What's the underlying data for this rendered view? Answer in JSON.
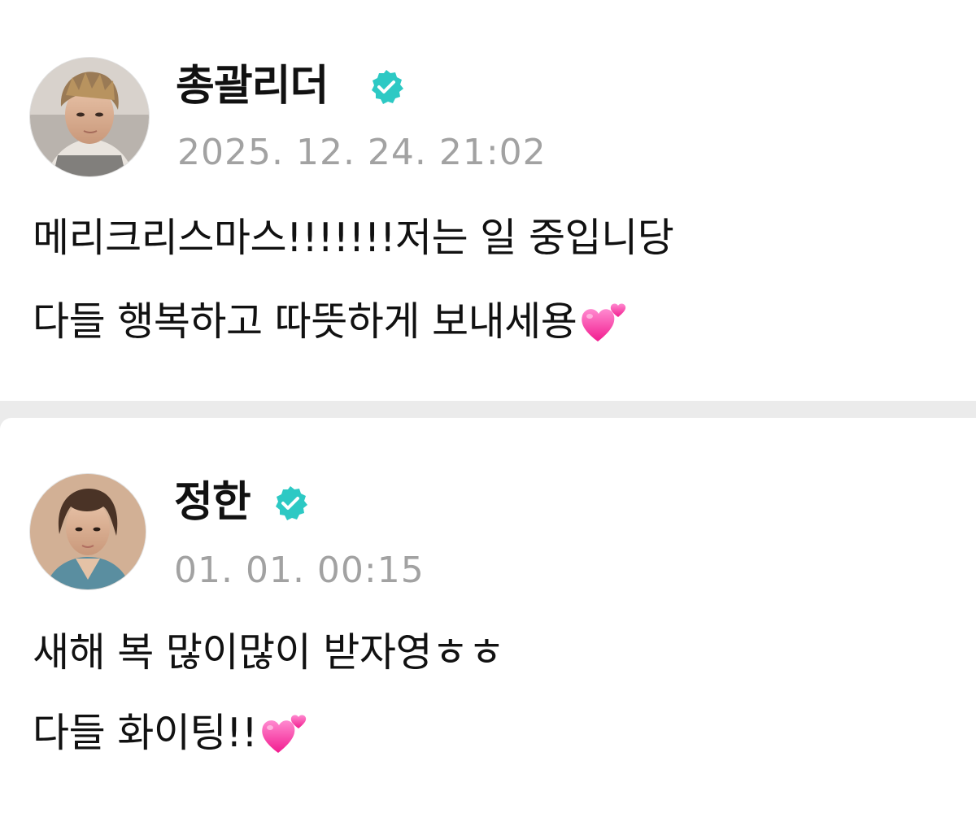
{
  "posts": [
    {
      "author": "총괄리더",
      "verified": true,
      "timestamp": "2025. 12. 24. 21:02",
      "lines": [
        "메리크리스마스!!!!!!!저는 일 중입니당",
        "다들 행복하고 따뜻하게 보내세용"
      ],
      "trailing_icon": "two-hearts-icon",
      "avatar_icon": "profile-photo"
    },
    {
      "author": "정한",
      "verified": true,
      "timestamp": "01. 01. 00:15",
      "lines": [
        "새해 복 많이많이 받자영ㅎㅎ",
        "다들 화이팅!!"
      ],
      "trailing_icon": "two-hearts-icon",
      "avatar_icon": "profile-photo"
    }
  ],
  "colors": {
    "badge": "#2dc9c4",
    "heart": "#ff3fa4",
    "timestamp": "#a2a2a2",
    "divider": "#ebebeb"
  }
}
